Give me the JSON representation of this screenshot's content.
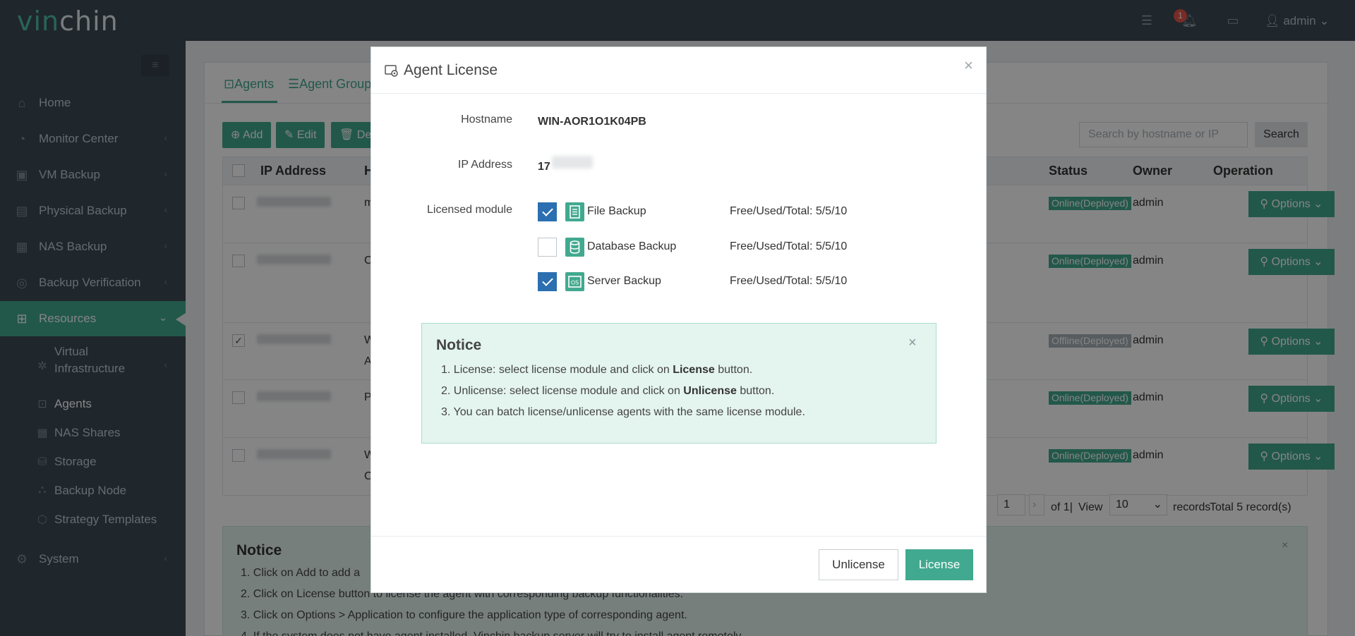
{
  "brand": {
    "logo_vi": "vin",
    "logo_rest": "chin"
  },
  "topbar": {
    "notification_count": "1",
    "user": "admin"
  },
  "sidebar": {
    "items": [
      {
        "label": "Home",
        "icon": "home-icon"
      },
      {
        "label": "Monitor Center",
        "icon": "monitor-icon"
      },
      {
        "label": "VM Backup",
        "icon": "vm-icon"
      },
      {
        "label": "Physical Backup",
        "icon": "physical-icon"
      },
      {
        "label": "NAS Backup",
        "icon": "nas-icon"
      },
      {
        "label": "Backup Verification",
        "icon": "verification-icon"
      },
      {
        "label": "Resources",
        "icon": "grid-icon"
      }
    ],
    "sub_items": [
      {
        "label": "Virtual",
        "label2": "Infrastructure"
      },
      {
        "label": "Agents"
      },
      {
        "label": "NAS Shares"
      },
      {
        "label": "Storage"
      },
      {
        "label": "Backup Node"
      },
      {
        "label": "Strategy Templates"
      }
    ],
    "system": "System"
  },
  "background": {
    "tabs": [
      "Agents",
      "Agent Group"
    ],
    "buttons": [
      "Add",
      "Edit",
      "De"
    ],
    "search_placeholder": "Search by hostname or IP",
    "search_label": "Search",
    "columns": [
      "IP Address",
      "H",
      "Status",
      "Owner",
      "Operation"
    ],
    "rows": [
      {
        "h": "m",
        "status": "Online(Deployed)",
        "owner": "admin",
        "checked": false
      },
      {
        "h": "C",
        "status": "Online(Deployed)",
        "owner": "admin",
        "checked": false
      },
      {
        "h": "W",
        "h2": "A",
        "status": "Offline(Deployed)",
        "owner": "admin",
        "checked": true
      },
      {
        "h": "P",
        "status": "Online(Deployed)",
        "owner": "admin",
        "checked": false
      },
      {
        "h": "W",
        "h2": "C",
        "status": "Online(Deployed)",
        "owner": "admin",
        "checked": false
      }
    ],
    "options_label": "Options",
    "pager": {
      "page": "1",
      "of": "of 1|",
      "view": "View",
      "per_page": "10",
      "records": "records",
      "total": "Total 5 record(s)"
    },
    "notice": {
      "title": "Notice",
      "lines": [
        "1. Click on Add to add a",
        "2. Click on License button to license the agent with corresponding backup functionalities.",
        "3. Click on Options > Application to configure the application type of corresponding agent.",
        "4. If the system does not have agent installed, Vinchin backup server will try to install agent remotely."
      ]
    }
  },
  "modal": {
    "title": "Agent License",
    "hostname_label": "Hostname",
    "hostname": "WIN-AOR1O1K04PB",
    "ip_label": "IP Address",
    "ip_prefix": "17",
    "module_label": "Licensed module",
    "modules": [
      {
        "name": "File Backup",
        "stat": "Free/Used/Total: 5/5/10",
        "checked": true
      },
      {
        "name": "Database Backup",
        "stat": "Free/Used/Total: 5/5/10",
        "checked": false
      },
      {
        "name": "Server Backup",
        "stat": "Free/Used/Total: 5/5/10",
        "checked": true
      }
    ],
    "notice": {
      "title": "Notice",
      "line1_a": "1. License: select license module and click on ",
      "line1_b": "License",
      "line1_c": " button.",
      "line2_a": "2. Unlicense: select license module and click on ",
      "line2_b": "Unlicense",
      "line2_c": " button.",
      "line3": "3. You can batch license/unlicense agents with the same license module."
    },
    "unlicense_label": "Unlicense",
    "license_label": "License"
  },
  "colors": {
    "accent": "#41a98f",
    "sidebar": "#3d4a55",
    "checkbox_on": "#2b6fb0"
  }
}
